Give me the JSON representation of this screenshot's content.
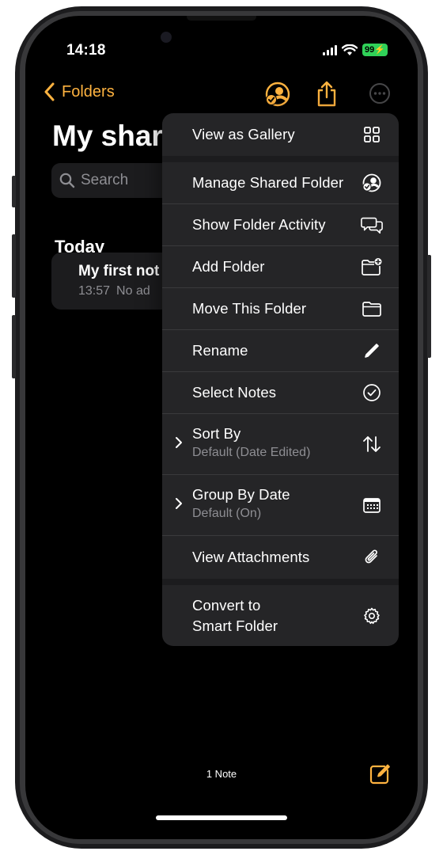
{
  "status_bar": {
    "time": "14:18",
    "battery": "99"
  },
  "nav": {
    "back_label": "Folders"
  },
  "page": {
    "title": "My shar",
    "search_placeholder": "Search",
    "section_header": "Today"
  },
  "note": {
    "title": "My first not",
    "date": "13:57",
    "preview": "No ad"
  },
  "menu": {
    "items": [
      {
        "label": "View as Gallery",
        "icon": "gallery-icon"
      },
      {
        "label": "Manage Shared Folder",
        "icon": "shared-folder-icon"
      },
      {
        "label": "Show Folder Activity",
        "icon": "activity-bubbles-icon"
      },
      {
        "label": "Add Folder",
        "icon": "folder-plus-icon"
      },
      {
        "label": "Move This Folder",
        "icon": "folder-icon"
      },
      {
        "label": "Rename",
        "icon": "pencil-icon"
      },
      {
        "label": "Select Notes",
        "icon": "checkmark-circle-icon"
      },
      {
        "label": "Sort By",
        "sublabel": "Default (Date Edited)",
        "icon": "sort-arrows-icon"
      },
      {
        "label": "Group By Date",
        "sublabel": "Default (On)",
        "icon": "calendar-icon"
      },
      {
        "label": "View Attachments",
        "icon": "paperclip-icon"
      },
      {
        "label": "Convert to",
        "label_line2": "Smart Folder",
        "icon": "gear-icon"
      }
    ]
  },
  "footer": {
    "count": "1 Note"
  },
  "colors": {
    "accent": "#ffb340",
    "background": "#000000",
    "menu_bg": "#252527",
    "battery": "#30d158"
  }
}
